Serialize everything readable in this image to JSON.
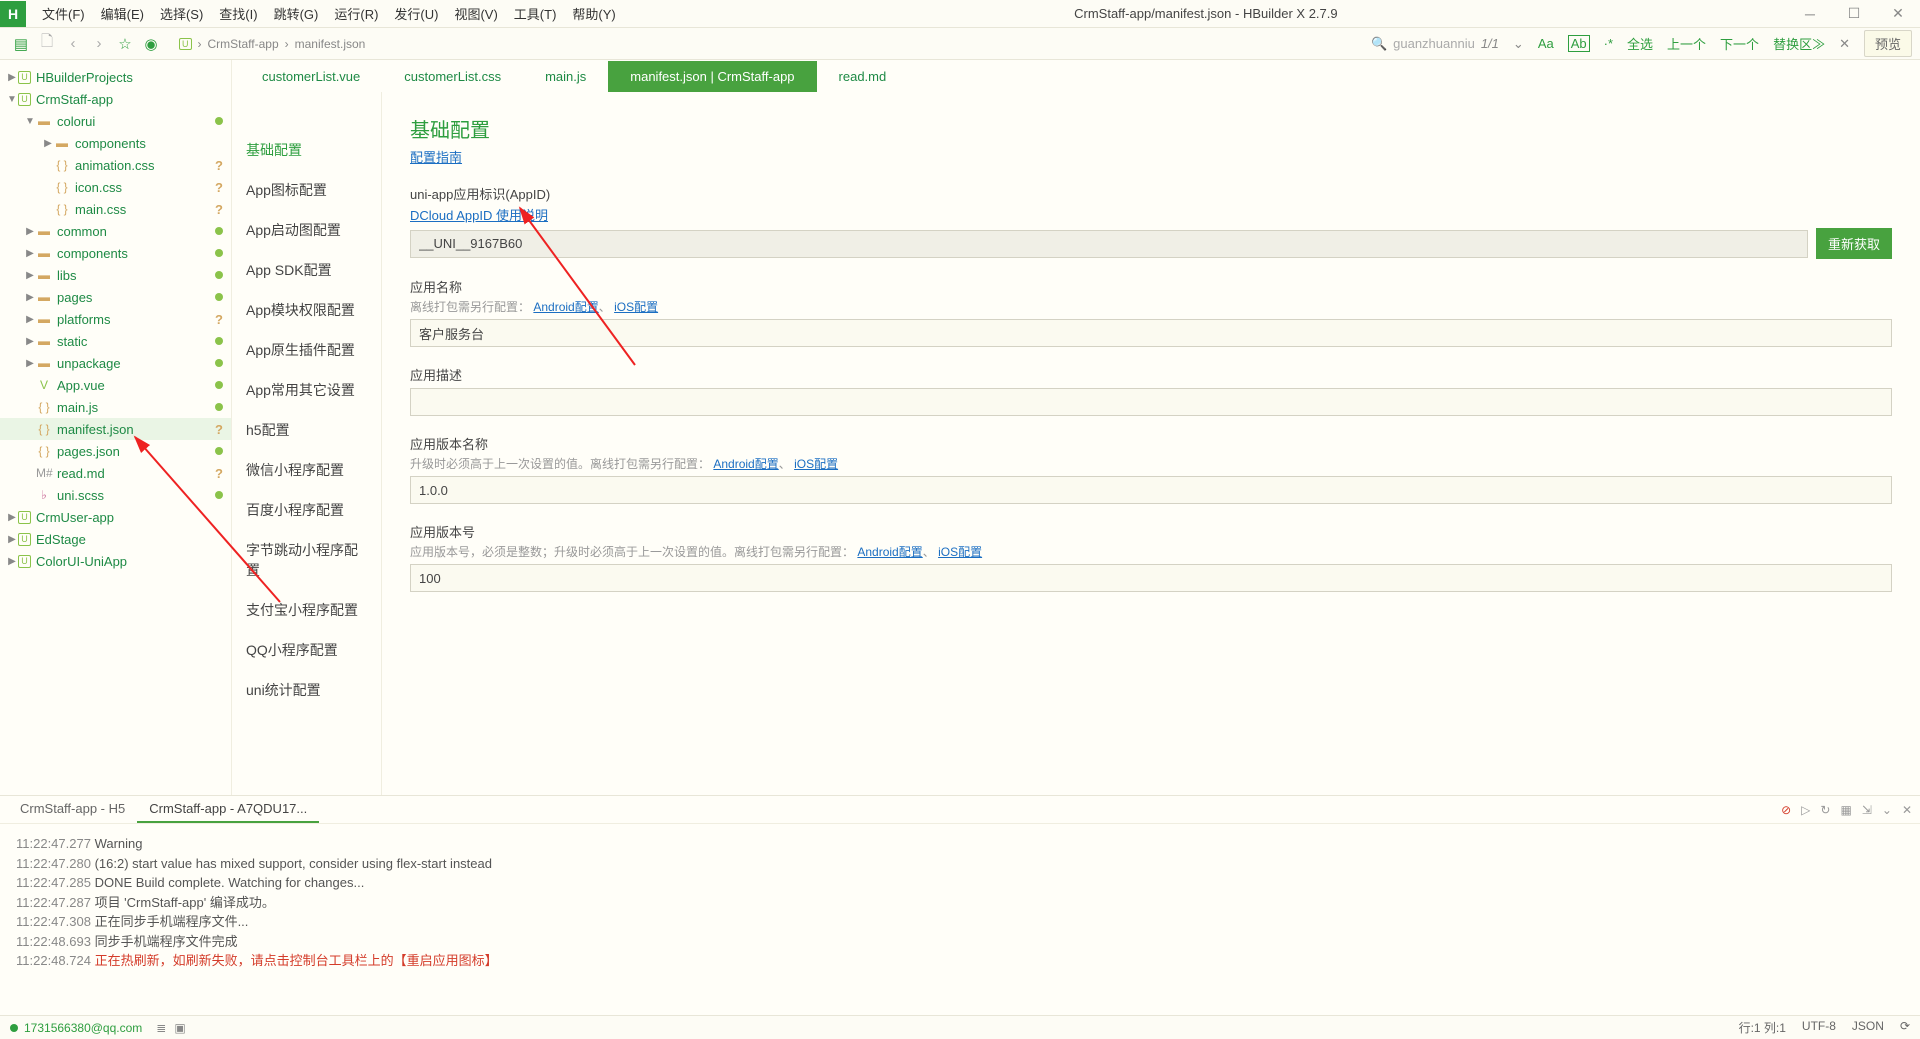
{
  "window": {
    "title": "CrmStaff-app/manifest.json - HBuilder X 2.7.9",
    "logo": "H"
  },
  "menus": [
    "文件(F)",
    "编辑(E)",
    "选择(S)",
    "查找(I)",
    "跳转(G)",
    "运行(R)",
    "发行(U)",
    "视图(V)",
    "工具(T)",
    "帮助(Y)"
  ],
  "breadcrumb": {
    "proj": "CrmStaff-app",
    "file": "manifest.json"
  },
  "search": {
    "placeholder": "guanzhuanniu"
  },
  "toolbar_right": {
    "counter": "1/1",
    "items": [
      "Aa",
      "Ab",
      "·*",
      "全选",
      "上一个",
      "下一个",
      "替换区≫",
      "✕"
    ],
    "preview": "预览"
  },
  "tree": [
    {
      "label": "HBuilderProjects",
      "depth": 0,
      "icon": "proj",
      "arrow": "▶"
    },
    {
      "label": "CrmStaff-app",
      "depth": 0,
      "icon": "proj",
      "arrow": "▼"
    },
    {
      "label": "colorui",
      "depth": 1,
      "icon": "folder",
      "arrow": "▼",
      "dot": true
    },
    {
      "label": "components",
      "depth": 2,
      "icon": "folder",
      "arrow": "▶"
    },
    {
      "label": "animation.css",
      "depth": 2,
      "icon": "braces",
      "q": true
    },
    {
      "label": "icon.css",
      "depth": 2,
      "icon": "braces",
      "q": true
    },
    {
      "label": "main.css",
      "depth": 2,
      "icon": "braces",
      "q": true
    },
    {
      "label": "common",
      "depth": 1,
      "icon": "folder",
      "arrow": "▶",
      "dot": true
    },
    {
      "label": "components",
      "depth": 1,
      "icon": "folder",
      "arrow": "▶",
      "dot": true
    },
    {
      "label": "libs",
      "depth": 1,
      "icon": "folder",
      "arrow": "▶",
      "dot": true
    },
    {
      "label": "pages",
      "depth": 1,
      "icon": "folder",
      "arrow": "▶",
      "dot": true
    },
    {
      "label": "platforms",
      "depth": 1,
      "icon": "folder",
      "arrow": "▶",
      "q": true
    },
    {
      "label": "static",
      "depth": 1,
      "icon": "folder",
      "arrow": "▶",
      "dot": true
    },
    {
      "label": "unpackage",
      "depth": 1,
      "icon": "folder",
      "arrow": "▶",
      "dot": true
    },
    {
      "label": "App.vue",
      "depth": 1,
      "icon": "vue",
      "dot": true
    },
    {
      "label": "main.js",
      "depth": 1,
      "icon": "braces",
      "dot": true
    },
    {
      "label": "manifest.json",
      "depth": 1,
      "icon": "braces",
      "q": true,
      "sel": true
    },
    {
      "label": "pages.json",
      "depth": 1,
      "icon": "braces",
      "dot": true
    },
    {
      "label": "read.md",
      "depth": 1,
      "icon": "hash",
      "q": true
    },
    {
      "label": "uni.scss",
      "depth": 1,
      "icon": "scss",
      "dot": true
    },
    {
      "label": "CrmUser-app",
      "depth": 0,
      "icon": "proj",
      "arrow": "▶"
    },
    {
      "label": "EdStage",
      "depth": 0,
      "icon": "proj",
      "arrow": "▶"
    },
    {
      "label": "ColorUI-UniApp",
      "depth": 0,
      "icon": "proj",
      "arrow": "▶"
    }
  ],
  "config_nav": [
    "基础配置",
    "App图标配置",
    "App启动图配置",
    "App SDK配置",
    "App模块权限配置",
    "App原生插件配置",
    "App常用其它设置",
    "h5配置",
    "微信小程序配置",
    "百度小程序配置",
    "字节跳动小程序配置",
    "支付宝小程序配置",
    "QQ小程序配置",
    "uni统计配置"
  ],
  "config_nav_active": 0,
  "tabs": [
    {
      "label": "customerList.vue"
    },
    {
      "label": "customerList.css"
    },
    {
      "label": "main.js"
    },
    {
      "label": "manifest.json | CrmStaff-app",
      "active": true
    },
    {
      "label": "read.md"
    }
  ],
  "form": {
    "title": "基础配置",
    "guide": "配置指南",
    "appid_label": "uni-app应用标识(AppID)",
    "appid_help": "DCloud AppID 使用说明",
    "appid_value": "__UNI__9167B60",
    "refetch": "重新获取",
    "name_label": "应用名称",
    "name_hint": "离线打包需另行配置：",
    "android_link": "Android配置",
    "ios_link": "iOS配置",
    "name_value": "客户服务台",
    "desc_label": "应用描述",
    "desc_value": "",
    "vername_label": "应用版本名称",
    "vername_hint": "升级时必须高于上一次设置的值。离线打包需另行配置：",
    "vername_value": "1.0.0",
    "vercode_label": "应用版本号",
    "vercode_hint": "应用版本号，必须是整数；升级时必须高于上一次设置的值。离线打包需另行配置：",
    "vercode_value": "100"
  },
  "console": {
    "tabs": [
      "CrmStaff-app - H5",
      "CrmStaff-app - A7QDU17..."
    ],
    "active": 1,
    "log": [
      {
        "ts": "11:22:47.277",
        "txt": "Warning"
      },
      {
        "ts": "11:22:47.280",
        "txt": "(16:2) start value has mixed support, consider using flex-start instead"
      },
      {
        "ts": "11:22:47.285",
        "txt": " DONE  Build complete. Watching for changes..."
      },
      {
        "ts": "11:22:47.287",
        "txt": "项目 'CrmStaff-app' 编译成功。"
      },
      {
        "ts": "11:22:47.308",
        "txt": "正在同步手机端程序文件..."
      },
      {
        "ts": "11:22:48.693",
        "txt": "同步手机端程序文件完成"
      },
      {
        "ts": "11:22:48.724",
        "txt": "正在热刷新，如刷新失败，请点击控制台工具栏上的【重启应用图标】",
        "red": true
      }
    ]
  },
  "status": {
    "user": "1731566380@qq.com",
    "pos": "行:1  列:1",
    "enc": "UTF-8",
    "lang": "JSON"
  }
}
